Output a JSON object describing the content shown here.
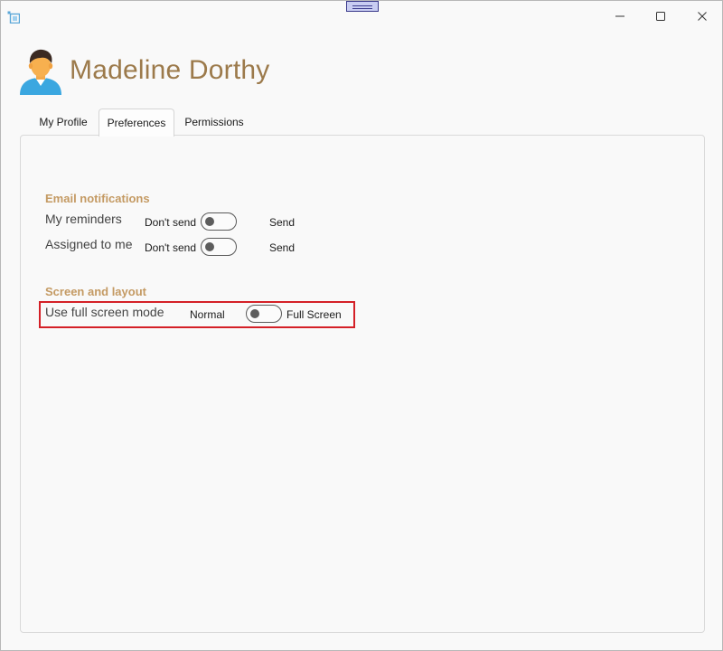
{
  "window": {
    "controls": {
      "minimize_icon": "minimize-icon",
      "maximize_icon": "maximize-icon",
      "close_icon": "close-icon"
    }
  },
  "header": {
    "user_name": "Madeline Dorthy",
    "avatar_icon": "user-avatar-icon"
  },
  "tabs": [
    {
      "label": "My Profile",
      "selected": false
    },
    {
      "label": "Preferences",
      "selected": true
    },
    {
      "label": "Permissions",
      "selected": false
    }
  ],
  "preferences": {
    "email_notifications": {
      "title": "Email notifications",
      "rows": [
        {
          "label": "My reminders",
          "off_label": "Don't send",
          "on_label": "Send",
          "on": false
        },
        {
          "label": "Assigned to me",
          "off_label": "Don't send",
          "on_label": "Send",
          "on": false
        }
      ]
    },
    "screen_layout": {
      "title": "Screen and layout",
      "rows": [
        {
          "label": "Use full screen mode",
          "off_label": "Normal",
          "on_label": "Full Screen",
          "on": false
        }
      ]
    }
  },
  "colors": {
    "accent_text": "#9c7a4b",
    "section_title": "#c49a63",
    "highlight_border": "#d42027"
  }
}
